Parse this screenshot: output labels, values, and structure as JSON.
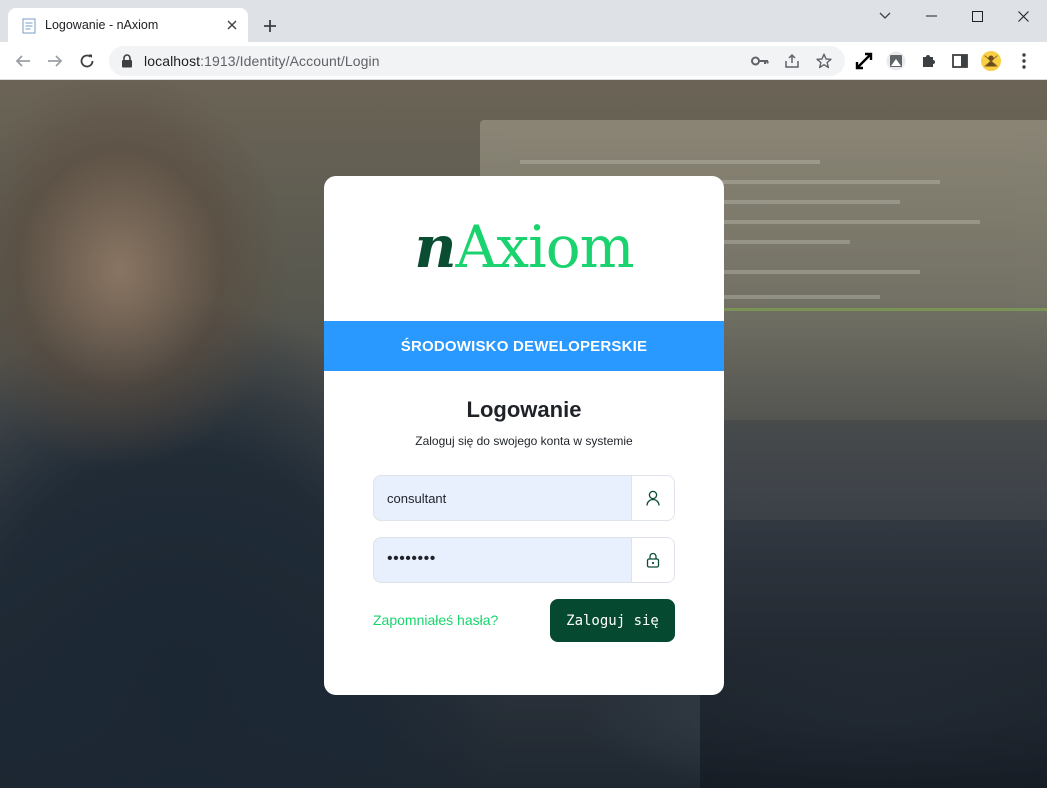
{
  "browser": {
    "tab_title": "Logowanie - nAxiom",
    "url_host": "localhost",
    "url_path": ":1913/Identity/Account/Login"
  },
  "icons": {
    "tab": "page-icon",
    "tab_close": "close-icon",
    "new_tab": "plus-icon",
    "minimize": "chevron-down-icon",
    "maximize": "square-icon",
    "close": "x-icon",
    "back": "arrow-left-icon",
    "forward": "arrow-right-icon",
    "reload": "reload-icon",
    "lock": "lock-icon",
    "key": "key-icon",
    "share": "share-icon",
    "star": "star-icon",
    "expand": "expand-arrows-icon",
    "extension1": "extension-icon",
    "puzzle": "puzzle-icon",
    "sidepanel": "side-panel-icon",
    "profile": "profile-avatar-icon",
    "menu": "kebab-menu-icon",
    "user": "user-icon",
    "password_lock": "padlock-icon"
  },
  "login": {
    "logo_prefix": "n",
    "logo_rest": "Axiom",
    "environment_banner": "ŚRODOWISKO DEWELOPERSKIE",
    "heading": "Logowanie",
    "subheading": "Zaloguj się do swojego konta w systemie",
    "username_value": "consultant",
    "password_value": "••••••••",
    "forgot_link": "Zapomniałeś hasła?",
    "login_button": "Zaloguj się"
  },
  "colors": {
    "logo_dark": "#0b4d33",
    "logo_green": "#1ad36e",
    "banner_blue": "#2998ff",
    "button_green": "#054a30",
    "link_green": "#1ad36e",
    "input_fill": "#e8f0fe"
  }
}
